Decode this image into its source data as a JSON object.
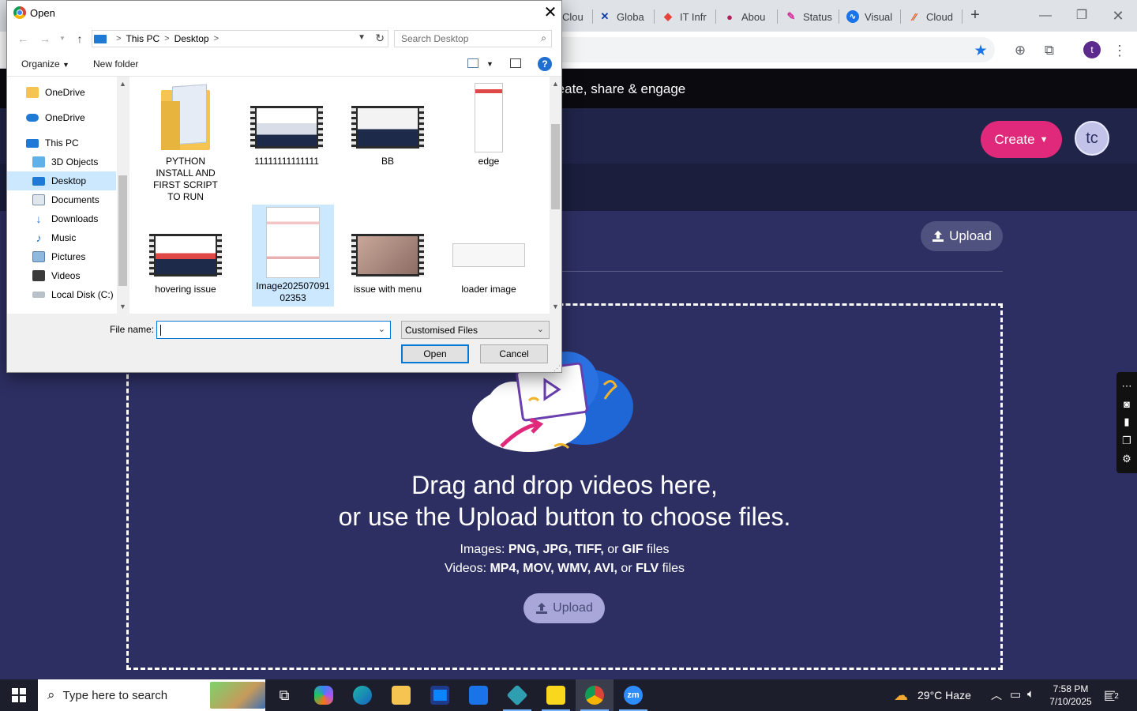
{
  "browser": {
    "tabs": [
      {
        "label": "Clou",
        "icon": "cloud-icon"
      },
      {
        "label": "Globa",
        "icon": "confluence-icon"
      },
      {
        "label": "IT Infr",
        "icon": "jira-icon"
      },
      {
        "label": "Abou",
        "icon": "atlassian-icon"
      },
      {
        "label": "Status",
        "icon": "statuspage-icon"
      },
      {
        "label": "Visual",
        "icon": "pulse-icon"
      },
      {
        "label": "Cloud",
        "icon": "cloud-brand-icon"
      }
    ],
    "new_tab": "+",
    "profile_initial": "t"
  },
  "page": {
    "tagline": "reate, share & engage",
    "create_label": "Create",
    "avatar_initials": "tc",
    "upload_label": "Upload",
    "drop_title_line1": "Drag and drop videos here,",
    "drop_title_line2": "or use the Upload button to choose files.",
    "images_prefix": "Images: ",
    "images_formats": "PNG, JPG, TIFF,",
    "images_or": " or ",
    "images_last": "GIF",
    "images_suffix": " files",
    "videos_prefix": "Videos: ",
    "videos_formats": "MP4, MOV, WMV, AVI,",
    "videos_or": " or ",
    "videos_last": "FLV",
    "videos_suffix": " files",
    "upload_label_2": "Upload"
  },
  "dialog": {
    "title": "Open",
    "breadcrumb": [
      "This PC",
      "Desktop"
    ],
    "search_placeholder": "Search Desktop",
    "organize_label": "Organize",
    "new_folder_label": "New folder",
    "help": "?",
    "nav_items": [
      {
        "label": "OneDrive",
        "icon": "folder-icon"
      },
      {
        "label": "OneDrive",
        "icon": "onedrive-cloud-icon"
      },
      {
        "label": "This PC",
        "icon": "this-pc-icon"
      },
      {
        "label": "3D Objects",
        "icon": "3d-objects-icon"
      },
      {
        "label": "Desktop",
        "icon": "desktop-icon"
      },
      {
        "label": "Documents",
        "icon": "documents-icon"
      },
      {
        "label": "Downloads",
        "icon": "downloads-icon"
      },
      {
        "label": "Music",
        "icon": "music-icon"
      },
      {
        "label": "Pictures",
        "icon": "pictures-icon"
      },
      {
        "label": "Videos",
        "icon": "videos-icon"
      },
      {
        "label": "Local Disk (C:)",
        "icon": "local-disk-icon"
      }
    ],
    "files": [
      {
        "label": "PYTHON INSTALL AND FIRST SCRIPT TO RUN",
        "kind": "folder"
      },
      {
        "label": "11111111111111",
        "kind": "video"
      },
      {
        "label": "BB",
        "kind": "video"
      },
      {
        "label": "edge",
        "kind": "image"
      },
      {
        "label": "hovering issue",
        "kind": "video"
      },
      {
        "label": "Image20250709102353",
        "kind": "image"
      },
      {
        "label": "issue with menu",
        "kind": "video"
      },
      {
        "label": "loader image",
        "kind": "image"
      }
    ],
    "file_name_label": "File name:",
    "file_name_value": "",
    "file_type": "Customised Files",
    "open_label": "Open",
    "cancel_label": "Cancel"
  },
  "taskbar": {
    "search_placeholder": "Type here to search",
    "weather": "29°C  Haze",
    "time": "7:58 PM",
    "date": "7/10/2025",
    "notifications": "2"
  }
}
